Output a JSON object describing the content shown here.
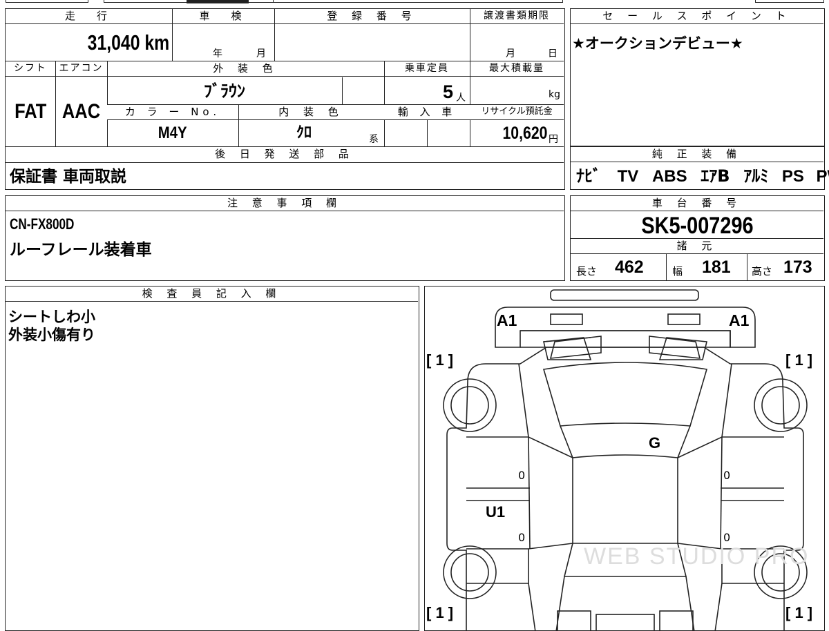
{
  "spec": {
    "mileage_label": "走　行",
    "mileage_value": "31,040 km",
    "inspection_label": "車　検",
    "inspection_year_unit": "年",
    "inspection_month_unit": "月",
    "registration_label": "登 録 番 号",
    "transfer_deadline_label": "譲渡書類期限",
    "transfer_month_unit": "月",
    "transfer_day_unit": "日",
    "shift_label": "シフト",
    "ac_label": "エアコン",
    "exterior_color_label": "外 装 色",
    "capacity_label": "乗車定員",
    "max_load_label": "最大積載量",
    "shift_value": "FAT",
    "ac_value": "AAC",
    "exterior_color_value": "ﾌﾞﾗｳﾝ",
    "capacity_value": "5",
    "capacity_unit": "人",
    "max_load_unit": "kg",
    "color_no_label": "カ ラ ー No.",
    "interior_color_label": "内 装 色",
    "import_label": "輸 入 車",
    "recycle_label": "リサイクル預託金",
    "color_no_value": "M4Y",
    "interior_color_value": "ｸﾛ",
    "interior_color_suffix": "系",
    "recycle_value": "10,620",
    "recycle_unit": "円",
    "later_parts_label": "後 日 発 送 部 品",
    "later_parts_value": "保証書 車両取説"
  },
  "sales_point": {
    "label": "セ ー ル ス ポ イ ン ト",
    "value": "★オークションデビュー★"
  },
  "equipment": {
    "label": "純 正 装 備",
    "items": [
      "ﾅﾋﾞ",
      "TV",
      "ABS",
      "ｴｱB",
      "ｱﾙﾐ",
      "PS",
      "PW"
    ]
  },
  "notes": {
    "label": "注 意 事 項 欄",
    "line1": "CN-FX800D",
    "line2": "ルーフレール装着車"
  },
  "chassis": {
    "label": "車 台 番 号",
    "value": "SK5-007296",
    "dimensions_label": "諸 元",
    "length_label": "長さ",
    "length_value": "462",
    "width_label": "幅",
    "width_value": "181",
    "height_label": "高さ",
    "height_value": "173"
  },
  "inspector": {
    "label": "検 査 員 記 入 欄",
    "line1": "シートしわ小",
    "line2": "外装小傷有り"
  },
  "diagram": {
    "front_left_mark": "A1",
    "front_right_mark": "A1",
    "glass_mark": "G",
    "left_door_mark": "U1",
    "tire_front_left": "[ 1 ]",
    "tire_front_right": "[ 1 ]",
    "tire_rear_left": "[ 1 ]",
    "tire_rear_right": "[ 1 ]",
    "panel_zero": "0",
    "watermark": "WEB STUDIO PRO"
  }
}
